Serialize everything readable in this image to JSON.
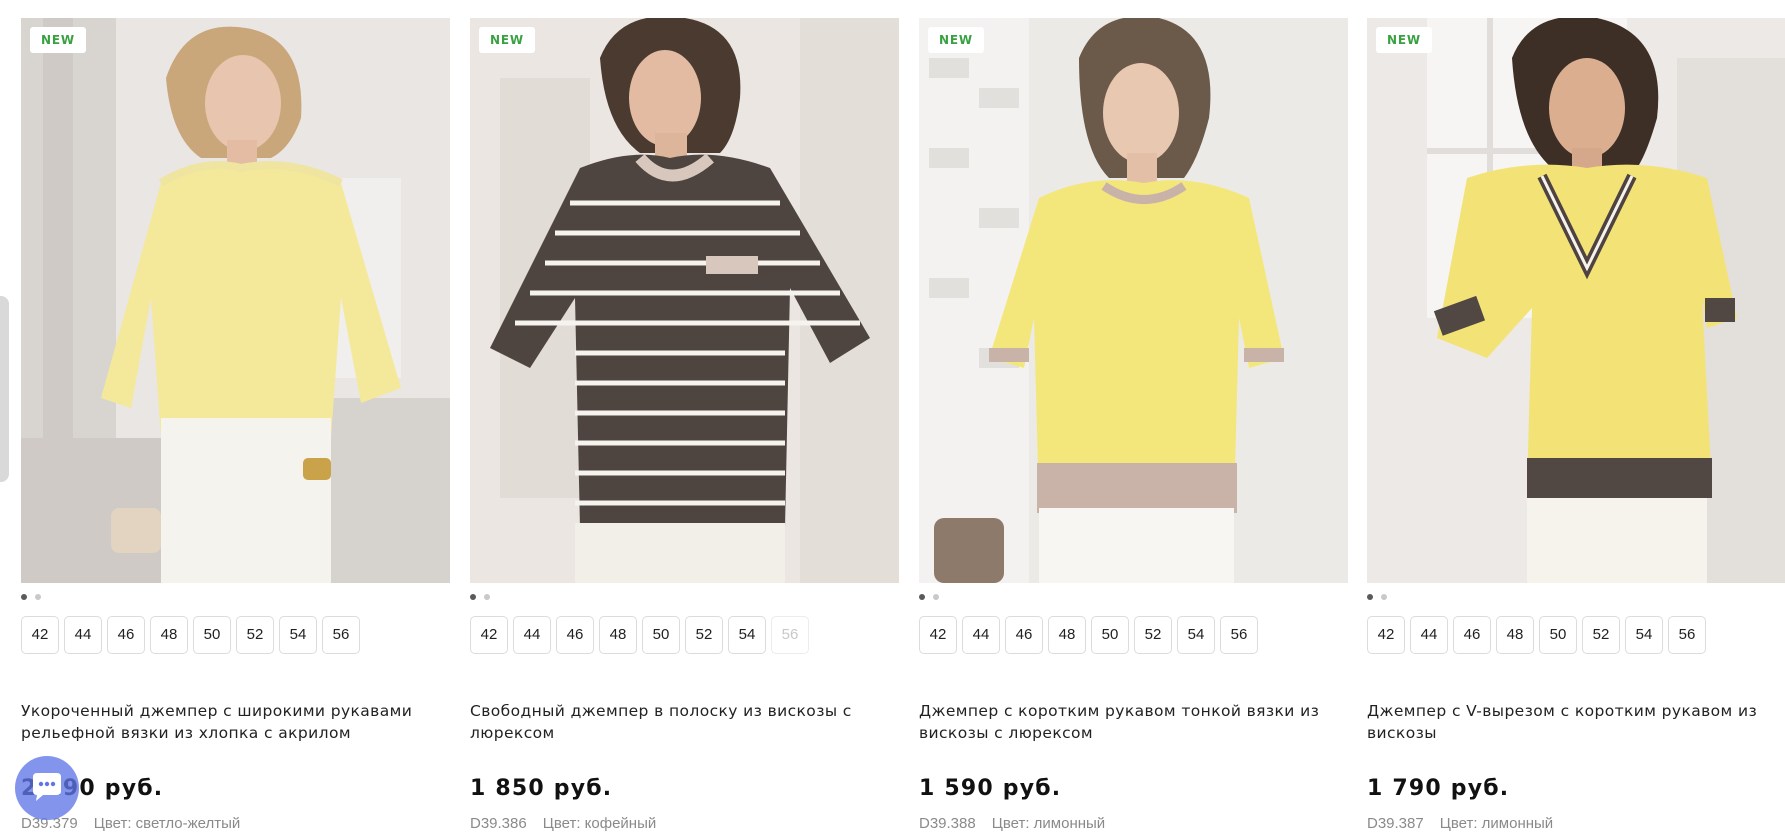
{
  "colors": {
    "badge_text": "#3aa142",
    "dot_active": "#5a5a5a",
    "dot_inactive": "#c9c9c9",
    "chat_button": "#6076e8"
  },
  "products": [
    {
      "badge": "NEW",
      "image": "yellow-waffle-knit-jumper-photo",
      "sizes": [
        {
          "label": "42",
          "available": true
        },
        {
          "label": "44",
          "available": true
        },
        {
          "label": "46",
          "available": true
        },
        {
          "label": "48",
          "available": true
        },
        {
          "label": "50",
          "available": true
        },
        {
          "label": "52",
          "available": true
        },
        {
          "label": "54",
          "available": true
        },
        {
          "label": "56",
          "available": true
        }
      ],
      "title": "Укороченный джемпер с широкими рукавами рельефной вязки из хлопка с акрилом",
      "price": "2 190 руб.",
      "sku": "D39.379",
      "color": "Цвет: светло-желтый"
    },
    {
      "badge": "NEW",
      "image": "striped-brown-jumper-photo",
      "sizes": [
        {
          "label": "42",
          "available": true
        },
        {
          "label": "44",
          "available": true
        },
        {
          "label": "46",
          "available": true
        },
        {
          "label": "48",
          "available": true
        },
        {
          "label": "50",
          "available": true
        },
        {
          "label": "52",
          "available": true
        },
        {
          "label": "54",
          "available": true
        },
        {
          "label": "56",
          "available": false
        }
      ],
      "title": "Свободный джемпер в полоску из вискозы с люрексом",
      "price": "1 850 руб.",
      "sku": "D39.386",
      "color": "Цвет: кофейный"
    },
    {
      "badge": "NEW",
      "image": "lemon-short-sleeve-jumper-photo",
      "sizes": [
        {
          "label": "42",
          "available": true
        },
        {
          "label": "44",
          "available": true
        },
        {
          "label": "46",
          "available": true
        },
        {
          "label": "48",
          "available": true
        },
        {
          "label": "50",
          "available": true
        },
        {
          "label": "52",
          "available": true
        },
        {
          "label": "54",
          "available": true
        },
        {
          "label": "56",
          "available": true
        }
      ],
      "title": "Джемпер с коротким рукавом тонкой вязки из вискозы с люрексом",
      "price": "1 590 руб.",
      "sku": "D39.388",
      "color": "Цвет: лимонный"
    },
    {
      "badge": "NEW",
      "image": "lemon-v-neck-jumper-photo",
      "sizes": [
        {
          "label": "42",
          "available": true
        },
        {
          "label": "44",
          "available": true
        },
        {
          "label": "46",
          "available": true
        },
        {
          "label": "48",
          "available": true
        },
        {
          "label": "50",
          "available": true
        },
        {
          "label": "52",
          "available": true
        },
        {
          "label": "54",
          "available": true
        },
        {
          "label": "56",
          "available": true
        }
      ],
      "title": "Джемпер с V-вырезом с коротким рукавом из вискозы",
      "price": "1 790 руб.",
      "sku": "D39.387",
      "color": "Цвет: лимонный"
    }
  ],
  "chat_icon": "chat-bubble-icon"
}
